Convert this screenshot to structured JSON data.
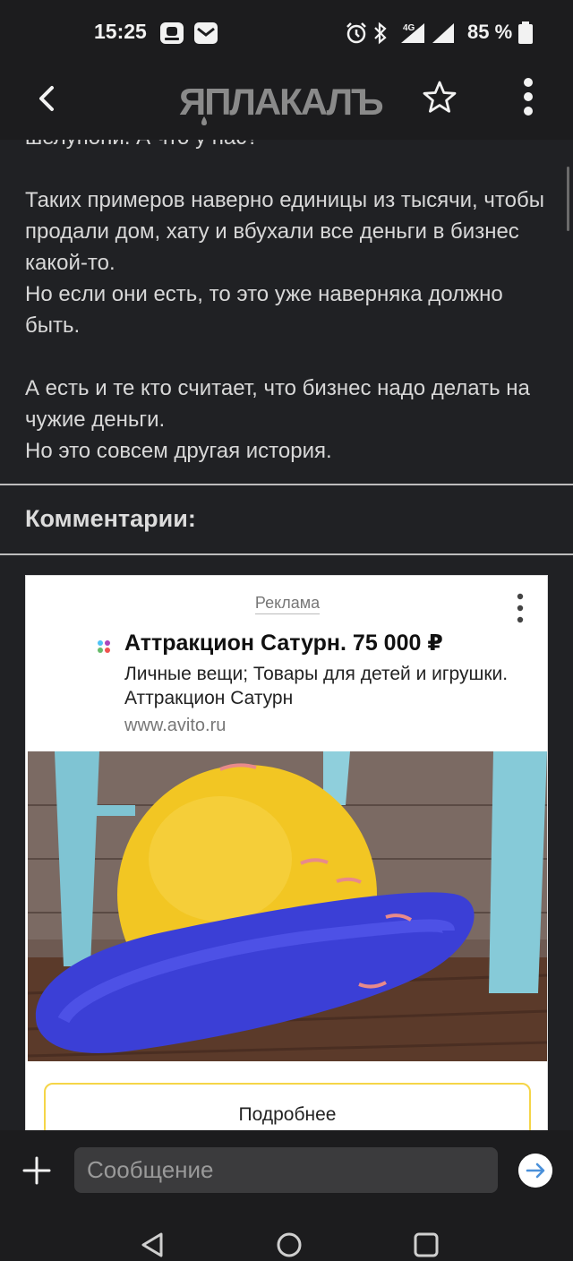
{
  "status_bar": {
    "time": "15:25",
    "battery": "85 %",
    "icons": [
      "notification-icon",
      "mail-icon",
      "alarm-icon",
      "bluetooth-icon",
      "signal-4g-icon",
      "signal-icon",
      "battery-icon"
    ]
  },
  "app_bar": {
    "logo_text": "ЯПЛАКАЛЪ",
    "icons": [
      "back-arrow-icon",
      "star-icon",
      "more-vertical-icon"
    ]
  },
  "post": {
    "paragraphs": [
      "шелупони. А что у нас?",
      "Таких примеров наверно единицы из тысячи, чтобы продали дом, хату и вбухали все деньги в бизнес какой-то.\nНо если они есть, то это уже наверняка должно быть.",
      "А есть и те кто считает, что бизнес надо делать на чужие деньги.\nНо это совсем другая история."
    ]
  },
  "comments": {
    "heading": "Комментарии:"
  },
  "ad": {
    "label": "Реклама",
    "title": "Аттракцион Сатурн. 75 000 ₽",
    "description": "Личные вещи; Товары для детей и игрушки. Аттракцион Сатурн",
    "url": "www.avito.ru",
    "button_label": "Подробнее",
    "image_subject": "inflatable-saturn-ride-photo"
  },
  "message_bar": {
    "placeholder": "Сообщение",
    "value": ""
  },
  "nav_bar": {
    "icons": [
      "nav-back-icon",
      "nav-home-icon",
      "nav-recents-icon"
    ]
  },
  "colors": {
    "background": "#202124",
    "bar": "#1c1c1e",
    "ad_button_border": "#f5d548",
    "send_arrow": "#4a90d9"
  }
}
